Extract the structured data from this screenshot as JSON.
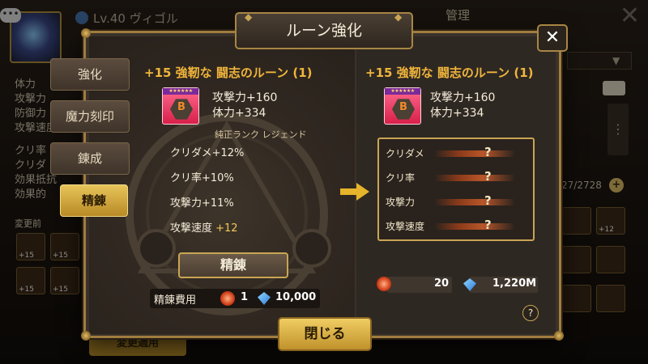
{
  "background": {
    "chat_icon": "•••",
    "level_text": "Lv.40 ヴィゴル",
    "manage_label": "管理",
    "close_glyph": "✕",
    "stats": [
      "体力",
      "攻撃力",
      "防御力",
      "攻撃速度"
    ],
    "stats2": [
      "クリ率",
      "クリダ",
      "効果抵抗",
      "効果的"
    ],
    "before_label": "変更前",
    "apply_label": "変更適用",
    "rune_count": "27/2728",
    "plus_label": "+",
    "rune_level": "+15",
    "rune_level_2": "+12"
  },
  "modal": {
    "title": "ルーン強化",
    "close_glyph": "✕",
    "tabs": [
      "強化",
      "魔力刻印",
      "錬成",
      "精錬"
    ],
    "active_tab": "精錬",
    "left": {
      "rune_title": "+15 強靭な 闘志のルーン (1)",
      "main_stat_1": "攻撃力+160",
      "main_stat_2": "体力+334",
      "grade_label": "純正ランク レジェンド",
      "substats": [
        {
          "label": "クリダメ+12%",
          "extra": ""
        },
        {
          "label": "クリ率+10%",
          "extra": ""
        },
        {
          "label": "攻撃力+11%",
          "extra": ""
        },
        {
          "label": "攻撃速度 ",
          "extra": "+12"
        }
      ],
      "refine_button": "精錬",
      "cost_label": "精錬費用",
      "cost_stones": "1",
      "cost_crystals": "10,000"
    },
    "right": {
      "rune_title": "+15 強靭な 闘志のルーン (1)",
      "main_stat_1": "攻撃力+160",
      "main_stat_2": "体力+334",
      "unknown_rows": [
        {
          "label": "クリダメ",
          "value": "?"
        },
        {
          "label": "クリ率",
          "value": "?"
        },
        {
          "label": "攻撃力",
          "value": "?"
        },
        {
          "label": "攻撃速度",
          "value": "?"
        }
      ],
      "owned_stones": "20",
      "owned_crystals": "1,220M",
      "help_glyph": "?"
    },
    "close_button": "閉じる"
  },
  "colors": {
    "accent_gold": "#c9a554",
    "rune_title": "#f0b53c",
    "highlight": "#f3c85a"
  }
}
